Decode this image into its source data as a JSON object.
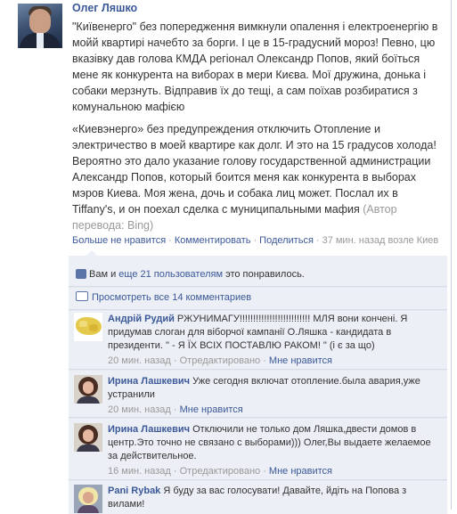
{
  "post": {
    "author": "Олег Ляшко",
    "text_ua": "\"Київенерго\" без попередження вимкнули опалення і електроенергію в мойй квартирі начебто за борги. І це в 15-градусний мороз! Певно, цю вказівку дав голова КМДА регіонал Олександр Попов, який боїться мене як конкурента на виборах в мери Києва. Мої дружина, донька і собаки мерзнуть. Відправив їх до тещі, а сам поїхав розбиратися з комунальною мафією",
    "text_ru": "«Киевэнерго» без предупреждения отключить Отопление и электричество в моей квартире как долг. И это на 15 градусов холода! Вероятно это дало указание голову государственной администрации Александр Попов, который боится меня как конкурента в выборах мэров Киева. Моя жена, дочь и собака лиц может. Послал их в Tiffany's, и он поехал сделка с муниципальными мафия",
    "translation_note": "(Автор перевода: Bing)",
    "actions": {
      "unlike": "Больше не нравится",
      "comment": "Комментировать",
      "share": "Поделиться",
      "time_location": "37 мин. назад возле Киев"
    }
  },
  "feedback": {
    "likes": {
      "prefix": "Вам и ",
      "link": "еще 21 пользователям",
      "suffix": " это понравилось."
    },
    "view_all": "Просмотреть все 14 комментариев",
    "comments": [
      {
        "name": "Андрій Рудий",
        "text": "РЖУНИМАГУ!!!!!!!!!!!!!!!!!!!!!!!!!! МЛЯ вони кончені. Я придумав слоган для віборчої кампанії О.Ляшка - кандидата в президенти. \" - Я ЇХ ВСІХ ПОСТАВЛЮ РАКОМ! \" (і є за що)",
        "time": "20 мин. назад",
        "edited": "Отредактировано",
        "like": "Мне нравится"
      },
      {
        "name": "Ирина Лашкевич",
        "text": "Уже сегодня включат отопление.была авария,уже устранили",
        "time": "20 мин. назад",
        "like": "Мне нравится"
      },
      {
        "name": "Ирина Лашкевич",
        "text": "Отключили не только дом Ляшка,двести домов в центр.Это точно не связано с выборами))) Олег,Вы выдаете желаемое за действительное.",
        "time": "16 мин. назад",
        "edited": "Отредактировано",
        "like": "Мне нравится"
      },
      {
        "name": "Pani Rybak",
        "text": "Я буду за вас голосувати! Давайте, йдіть на Попова з вилами!"
      }
    ]
  },
  "colors": {
    "link": "#3b5998",
    "feedback_bg": "#eceff5",
    "meta": "#999999"
  },
  "icons": [
    "thumbs-up-icon",
    "comment-bubble-icon"
  ]
}
